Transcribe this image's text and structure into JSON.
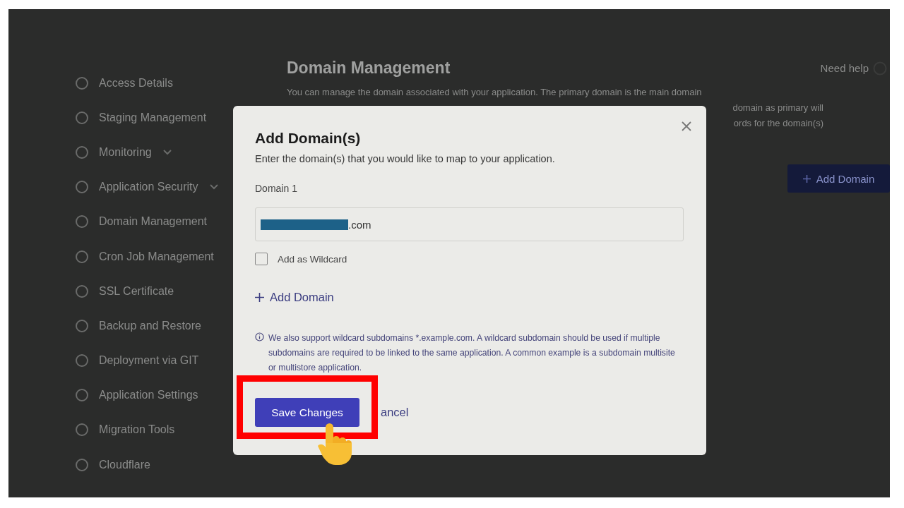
{
  "sidebar": {
    "items": [
      {
        "label": "Access Details",
        "expandable": false
      },
      {
        "label": "Staging Management",
        "expandable": false
      },
      {
        "label": "Monitoring",
        "expandable": true
      },
      {
        "label": "Application Security",
        "expandable": true
      },
      {
        "label": "Domain Management",
        "expandable": false
      },
      {
        "label": "Cron Job Management",
        "expandable": false
      },
      {
        "label": "SSL Certificate",
        "expandable": false
      },
      {
        "label": "Backup and Restore",
        "expandable": false
      },
      {
        "label": "Deployment via GIT",
        "expandable": false
      },
      {
        "label": "Application Settings",
        "expandable": false
      },
      {
        "label": "Migration Tools",
        "expandable": false
      },
      {
        "label": "Cloudflare",
        "expandable": false
      }
    ]
  },
  "page": {
    "title": "Domain Management",
    "help": "Need help",
    "description_lines": [
      "You can manage the domain associated with your application. The primary domain is the main domain",
      "domain as primary will",
      "ords for the domain(s)"
    ],
    "add_button": "Add Domain"
  },
  "modal": {
    "title": "Add Domain(s)",
    "subtitle": "Enter the domain(s) that you would like to map to your application.",
    "fields": [
      {
        "label": "Domain 1",
        "value": ".com",
        "wildcard_label": "Add as Wildcard",
        "wildcard_checked": false
      }
    ],
    "add_link": "Add Domain",
    "note": "We also support wildcard subdomains *.example.com. A wildcard subdomain should be used if multiple subdomains are required to be linked to the same application. A common example is a subdomain multisite or multistore application.",
    "save_button": "Save Changes",
    "cancel": "ancel"
  }
}
